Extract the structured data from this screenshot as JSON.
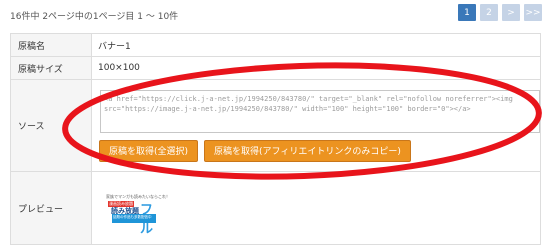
{
  "result_count": "16件中 2ページ中の1ページ目 1 〜 10件",
  "pager": {
    "pages": [
      "1",
      "2"
    ],
    "next": ">",
    "last": ">>",
    "current": "1"
  },
  "table": {
    "name_label": "原稿名",
    "name_value": "バナー1",
    "size_label": "原稿サイズ",
    "size_value": "100×100",
    "source_label": "ソース",
    "source_text": "<a href=\"https://click.j-a-net.jp/1994250/843780/\" target=\"_blank\" rel=\"nofollow noreferrer\"><img src=\"https://image.j-a-net.jp/1994250/843780/\" width=\"100\" height=\"100\" border=\"0\"></a>",
    "button_copy_all": "原稿を取得(全選択)",
    "button_copy_affiliate": "原稿を取得(アフィリエイトリンクのみコピー)",
    "preview_label": "プレビュー"
  },
  "preview": {
    "top_text": "家族でマンガも読みたいならこれ！",
    "badge": "漫画読み放題",
    "main_text": "読み放題",
    "accent_text": "フル",
    "band_text": "話題の作品も多数配信中"
  },
  "colors": {
    "button_bg": "#ec9320",
    "page_active": "#3a78b9",
    "page_inactive": "#c5d3e6",
    "highlight_ellipse": "#e8141b"
  }
}
